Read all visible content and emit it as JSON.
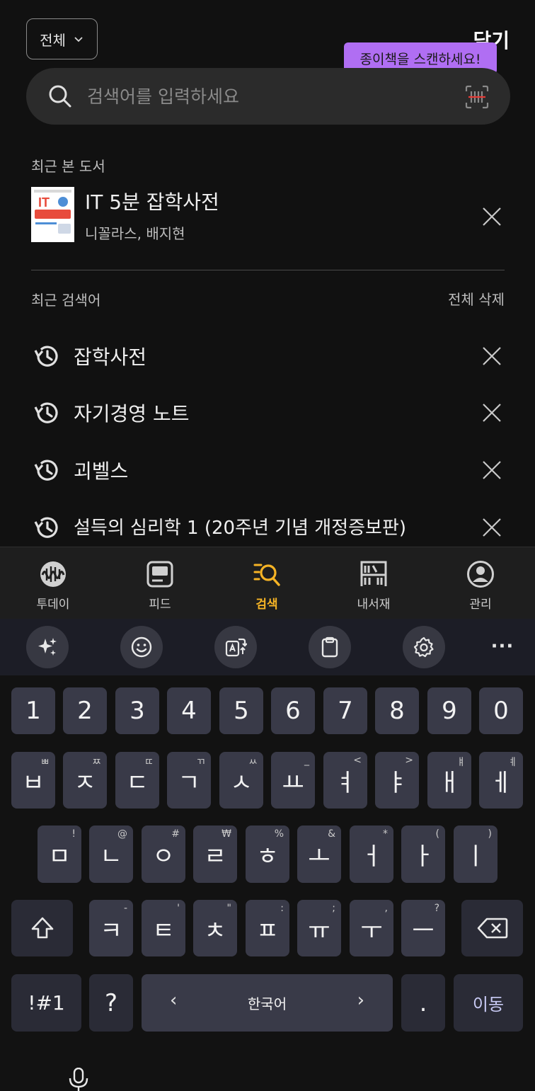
{
  "header": {
    "filter_label": "전체",
    "close_label": "닫기",
    "scan_tooltip": "종이책을 스캔하세요!"
  },
  "search": {
    "placeholder": "검색어를 입력하세요"
  },
  "recent_books": {
    "title": "최근 본 도서",
    "items": [
      {
        "title": "IT 5분 잡학사전",
        "author": "니꼴라스, 배지현",
        "cover_text": "IT"
      }
    ]
  },
  "recent_searches": {
    "title": "최근 검색어",
    "clear_all": "전체 삭제",
    "items": [
      {
        "text": "잡학사전"
      },
      {
        "text": "자기경영 노트"
      },
      {
        "text": "괴벨스"
      },
      {
        "text": "설득의 심리학 1 (20주년 기념 개정증보판)"
      }
    ]
  },
  "bottom_nav": {
    "active_color": "#f5b325",
    "items": [
      {
        "label": "투데이",
        "icon": "today-wave-icon"
      },
      {
        "label": "피드",
        "icon": "feed-icon"
      },
      {
        "label": "검색",
        "icon": "search-list-icon",
        "active": true
      },
      {
        "label": "내서재",
        "icon": "library-icon"
      },
      {
        "label": "관리",
        "icon": "profile-icon"
      }
    ]
  },
  "keyboard": {
    "toolbar": [
      "sparkle-icon",
      "emoji-icon",
      "translate-icon",
      "clipboard-icon",
      "settings-icon",
      "more-icon"
    ],
    "more_label": "···",
    "row_numbers": [
      "1",
      "2",
      "3",
      "4",
      "5",
      "6",
      "7",
      "8",
      "9",
      "0"
    ],
    "row1": [
      {
        "main": "ㅂ",
        "sub": "ㅃ"
      },
      {
        "main": "ㅈ",
        "sub": "ㅉ"
      },
      {
        "main": "ㄷ",
        "sub": "ㄸ"
      },
      {
        "main": "ㄱ",
        "sub": "ㄲ"
      },
      {
        "main": "ㅅ",
        "sub": "ㅆ"
      },
      {
        "main": "ㅛ",
        "sub": "_"
      },
      {
        "main": "ㅕ",
        "sub": "<"
      },
      {
        "main": "ㅑ",
        "sub": ">"
      },
      {
        "main": "ㅐ",
        "sub": "ㅒ"
      },
      {
        "main": "ㅔ",
        "sub": "ㅖ"
      }
    ],
    "row2": [
      {
        "main": "ㅁ",
        "sub": "!"
      },
      {
        "main": "ㄴ",
        "sub": "@"
      },
      {
        "main": "ㅇ",
        "sub": "#"
      },
      {
        "main": "ㄹ",
        "sub": "₩"
      },
      {
        "main": "ㅎ",
        "sub": "%"
      },
      {
        "main": "ㅗ",
        "sub": "&"
      },
      {
        "main": "ㅓ",
        "sub": "*"
      },
      {
        "main": "ㅏ",
        "sub": "("
      },
      {
        "main": "ㅣ",
        "sub": ")"
      }
    ],
    "row3": [
      {
        "main": "ㅋ",
        "sub": "-"
      },
      {
        "main": "ㅌ",
        "sub": "'"
      },
      {
        "main": "ㅊ",
        "sub": "\""
      },
      {
        "main": "ㅍ",
        "sub": ":"
      },
      {
        "main": "ㅠ",
        "sub": ";"
      },
      {
        "main": "ㅜ",
        "sub": ","
      },
      {
        "main": "ㅡ",
        "sub": "?"
      }
    ],
    "symbols_label": "!#1",
    "question_label": "?",
    "space_label": "한국어",
    "left_arrow": "‹",
    "right_arrow": "›",
    "period_label": ".",
    "enter_label": "이동"
  }
}
